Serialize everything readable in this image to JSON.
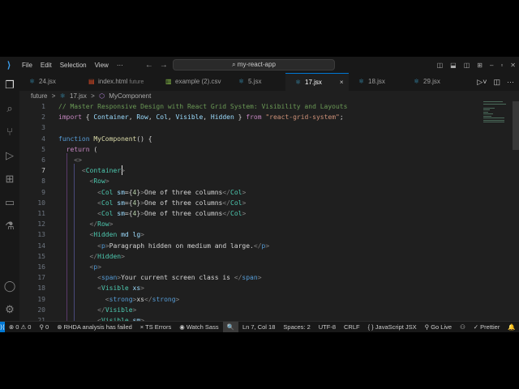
{
  "menu": [
    "File",
    "Edit",
    "Selection",
    "View",
    "···"
  ],
  "search": "my-react-app",
  "tabs": [
    {
      "label": "24.jsx",
      "icon": "⚛",
      "color": "#3ba0c8"
    },
    {
      "label": "index.html",
      "desc": "future",
      "icon": "▤",
      "color": "#e44d26"
    },
    {
      "label": "example (2).csv",
      "icon": "▥",
      "color": "#8bc34a"
    },
    {
      "label": "5.jsx",
      "icon": "⚛",
      "color": "#3ba0c8"
    },
    {
      "label": "17.jsx",
      "icon": "⚛",
      "color": "#3ba0c8",
      "active": true,
      "close": "×"
    },
    {
      "label": "18.jsx",
      "icon": "⚛",
      "color": "#3ba0c8"
    },
    {
      "label": "29.jsx",
      "icon": "⚛",
      "color": "#3ba0c8"
    }
  ],
  "breadcrumb": [
    "future",
    ">",
    "17.jsx",
    ">",
    "MyComponent"
  ],
  "cursor_line": 7,
  "code": [
    [
      [
        "// Master Responsive Design with React Grid System: Visibility and Layouts",
        "cm"
      ]
    ],
    [
      [
        "import",
        "kw2"
      ],
      [
        " { ",
        "tx"
      ],
      [
        "Container",
        "id"
      ],
      [
        ", ",
        "tx"
      ],
      [
        "Row",
        "id"
      ],
      [
        ", ",
        "tx"
      ],
      [
        "Col",
        "id"
      ],
      [
        ", ",
        "tx"
      ],
      [
        "Visible",
        "id"
      ],
      [
        ", ",
        "tx"
      ],
      [
        "Hidden",
        "id"
      ],
      [
        " } ",
        "tx"
      ],
      [
        "from",
        "kw2"
      ],
      [
        " ",
        "tx"
      ],
      [
        "\"react-grid-system\"",
        "str"
      ],
      [
        ";",
        "tx"
      ]
    ],
    [],
    [
      [
        "function",
        "kw"
      ],
      [
        " ",
        "tx"
      ],
      [
        "MyComponent",
        "fn"
      ],
      [
        "() {",
        "tx"
      ]
    ],
    [
      [
        "  ",
        "tx"
      ],
      [
        "return",
        "kw2"
      ],
      [
        " (",
        "tx"
      ]
    ],
    [
      [
        "    ",
        "tx"
      ],
      [
        "<>",
        "br"
      ]
    ],
    [
      [
        "      ",
        "tx"
      ],
      [
        "<",
        "br"
      ],
      [
        "Container",
        "tag"
      ],
      [
        ">",
        "br"
      ]
    ],
    [
      [
        "        ",
        "tx"
      ],
      [
        "<",
        "br"
      ],
      [
        "Row",
        "tag"
      ],
      [
        ">",
        "br"
      ]
    ],
    [
      [
        "          ",
        "tx"
      ],
      [
        "<",
        "br"
      ],
      [
        "Col",
        "tag"
      ],
      [
        " sm",
        "at"
      ],
      [
        "={",
        "tx"
      ],
      [
        "4",
        "num"
      ],
      [
        "}",
        "tx"
      ],
      [
        ">",
        "br"
      ],
      [
        "One of three columns",
        "tx"
      ],
      [
        "</",
        "br"
      ],
      [
        "Col",
        "tag"
      ],
      [
        ">",
        "br"
      ]
    ],
    [
      [
        "          ",
        "tx"
      ],
      [
        "<",
        "br"
      ],
      [
        "Col",
        "tag"
      ],
      [
        " sm",
        "at"
      ],
      [
        "={",
        "tx"
      ],
      [
        "4",
        "num"
      ],
      [
        "}",
        "tx"
      ],
      [
        ">",
        "br"
      ],
      [
        "One of three columns",
        "tx"
      ],
      [
        "</",
        "br"
      ],
      [
        "Col",
        "tag"
      ],
      [
        ">",
        "br"
      ]
    ],
    [
      [
        "          ",
        "tx"
      ],
      [
        "<",
        "br"
      ],
      [
        "Col",
        "tag"
      ],
      [
        " sm",
        "at"
      ],
      [
        "={",
        "tx"
      ],
      [
        "4",
        "num"
      ],
      [
        "}",
        "tx"
      ],
      [
        ">",
        "br"
      ],
      [
        "One of three columns",
        "tx"
      ],
      [
        "</",
        "br"
      ],
      [
        "Col",
        "tag"
      ],
      [
        ">",
        "br"
      ]
    ],
    [
      [
        "        ",
        "tx"
      ],
      [
        "</",
        "br"
      ],
      [
        "Row",
        "tag"
      ],
      [
        ">",
        "br"
      ]
    ],
    [
      [
        "        ",
        "tx"
      ],
      [
        "<",
        "br"
      ],
      [
        "Hidden",
        "tag"
      ],
      [
        " md lg",
        "at"
      ],
      [
        ">",
        "br"
      ]
    ],
    [
      [
        "          ",
        "tx"
      ],
      [
        "<",
        "br"
      ],
      [
        "p",
        "kw"
      ],
      [
        ">",
        "br"
      ],
      [
        "Paragraph hidden on medium and large.",
        "tx"
      ],
      [
        "</",
        "br"
      ],
      [
        "p",
        "kw"
      ],
      [
        ">",
        "br"
      ]
    ],
    [
      [
        "        ",
        "tx"
      ],
      [
        "</",
        "br"
      ],
      [
        "Hidden",
        "tag"
      ],
      [
        ">",
        "br"
      ]
    ],
    [
      [
        "        ",
        "tx"
      ],
      [
        "<",
        "br"
      ],
      [
        "p",
        "kw"
      ],
      [
        ">",
        "br"
      ]
    ],
    [
      [
        "          ",
        "tx"
      ],
      [
        "<",
        "br"
      ],
      [
        "span",
        "kw"
      ],
      [
        ">",
        "br"
      ],
      [
        "Your current screen class is ",
        "tx"
      ],
      [
        "</",
        "br"
      ],
      [
        "span",
        "kw"
      ],
      [
        ">",
        "br"
      ]
    ],
    [
      [
        "          ",
        "tx"
      ],
      [
        "<",
        "br"
      ],
      [
        "Visible",
        "tag"
      ],
      [
        " xs",
        "at"
      ],
      [
        ">",
        "br"
      ]
    ],
    [
      [
        "            ",
        "tx"
      ],
      [
        "<",
        "br"
      ],
      [
        "strong",
        "kw"
      ],
      [
        ">",
        "br"
      ],
      [
        "xs",
        "tx"
      ],
      [
        "</",
        "br"
      ],
      [
        "strong",
        "kw"
      ],
      [
        ">",
        "br"
      ]
    ],
    [
      [
        "          ",
        "tx"
      ],
      [
        "</",
        "br"
      ],
      [
        "Visible",
        "tag"
      ],
      [
        ">",
        "br"
      ]
    ],
    [
      [
        "          ",
        "tx"
      ],
      [
        "<",
        "br"
      ],
      [
        "Visible",
        "tag"
      ],
      [
        " sm",
        "at"
      ],
      [
        ">",
        "br"
      ]
    ]
  ],
  "status": {
    "problems": "⊗ 0 ⚠ 0",
    "ports": "⚲ 0",
    "rhda": "⊗ RHDA analysis has failed",
    "ts": "× TS Errors",
    "sass": "◉ Watch Sass",
    "zoom": "🔍",
    "position": "Ln 7, Col 18",
    "spaces": "Spaces: 2",
    "encoding": "UTF-8",
    "eol": "CRLF",
    "language": "{ } JavaScript JSX",
    "golive": "⚲ Go Live",
    "copilot": "⚇",
    "prettier": "✓ Prettier",
    "bell": "🔔"
  }
}
